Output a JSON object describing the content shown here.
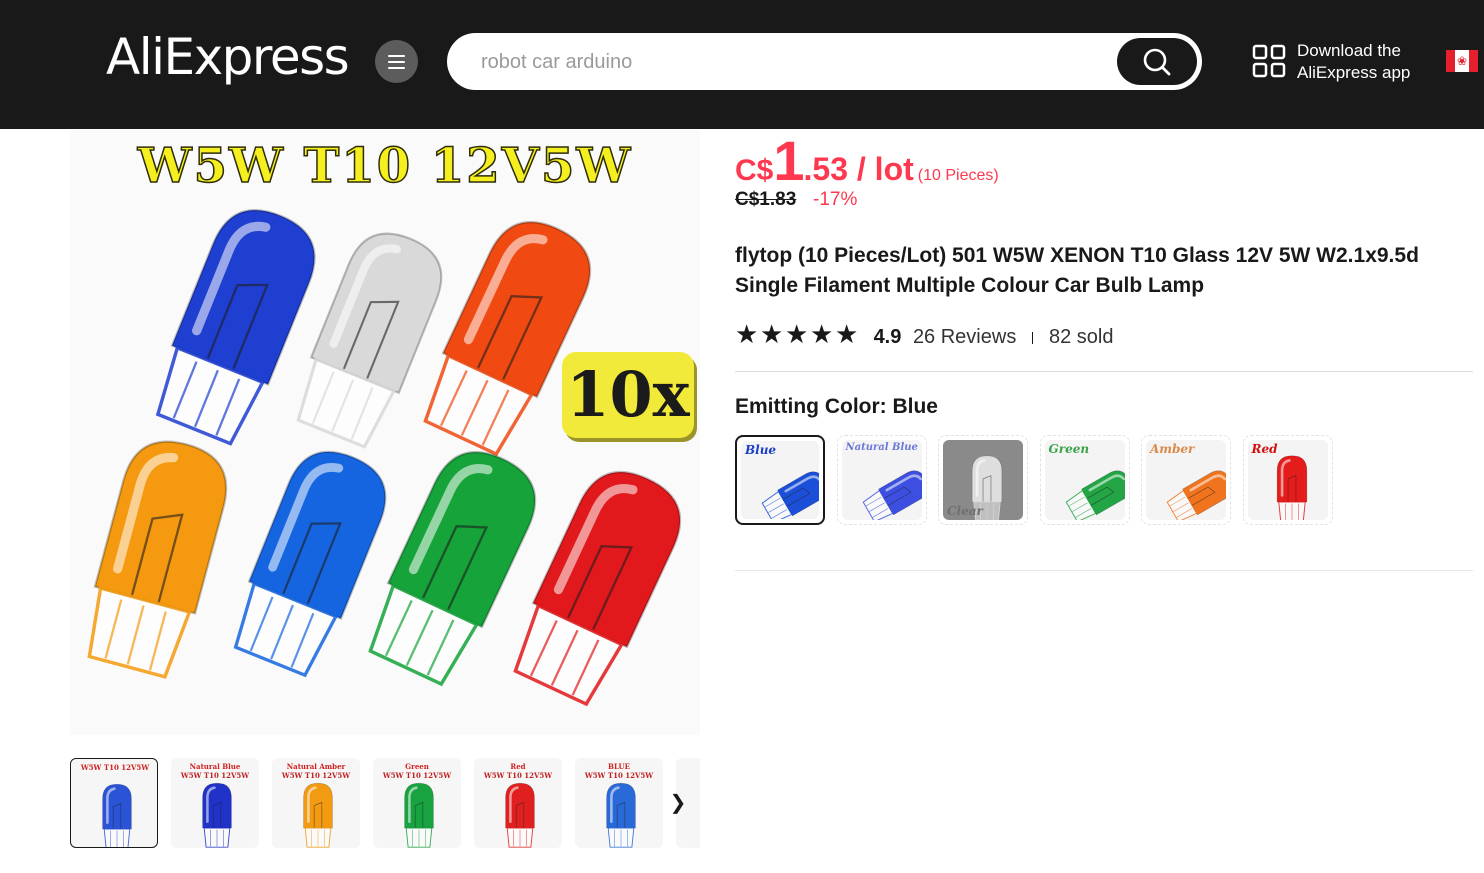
{
  "header": {
    "logo": "AliExpress",
    "search": {
      "placeholder": "robot car arduino"
    },
    "app_download": {
      "line1": "Download the",
      "line2": "AliExpress app"
    },
    "country": "Canada"
  },
  "gallery": {
    "main_title": "W5W T10 12V5W",
    "badge": "10x",
    "bulbs": [
      {
        "color": "#1f3fd1",
        "glass": "Blue"
      },
      {
        "color": "#d9d9d9",
        "glass": "Clear"
      },
      {
        "color": "#f04a12",
        "glass": "Orange"
      },
      {
        "color": "#f59a10",
        "glass": "Amber"
      },
      {
        "color": "#1565e0",
        "glass": "Blue"
      },
      {
        "color": "#15a33a",
        "glass": "Green"
      },
      {
        "color": "#e2191c",
        "glass": "Red"
      }
    ],
    "thumbnails": [
      {
        "caption": "W5W T10 12V5W",
        "sub": "",
        "color": "#2b53d6"
      },
      {
        "caption": "Natural Blue",
        "sub": "W5W T10 12V5W",
        "color": "#2032c8"
      },
      {
        "caption": "Natural Amber",
        "sub": "W5W T10 12V5W",
        "color": "#f29a12"
      },
      {
        "caption": "Green",
        "sub": "W5W T10 12V5W",
        "color": "#18a240"
      },
      {
        "caption": "Red",
        "sub": "W5W T10 12V5W",
        "color": "#e0201e"
      },
      {
        "caption": "BLUE",
        "sub": "W5W T10 12V5W",
        "color": "#2a69d8"
      },
      {
        "caption": "Bl",
        "sub": "",
        "color": "#cfd8f0"
      }
    ]
  },
  "product": {
    "currency": "C$",
    "price_int": "1",
    "price_dec": ".53 / lot",
    "pieces": "(10 Pieces)",
    "original_price": "C$1.83",
    "discount": "-17%",
    "title": "flytop (10 Pieces/Lot) 501 W5W XENON T10 Glass 12V 5W W2.1x9.5d Single Filament Multiple Colour Car Bulb Lamp",
    "rating": "4.9",
    "stars": 5,
    "reviews": "26 Reviews",
    "sold": "82 sold",
    "sku_label": "Emitting Color: Blue",
    "sku_options": [
      {
        "label": "Blue",
        "color": "#1c4fd8",
        "label_color": "#1a3cc8",
        "selected": true
      },
      {
        "label": "Natural Blue",
        "color": "#3d4fe0",
        "label_color": "#6a78d8",
        "selected": false
      },
      {
        "label": "Clear",
        "color": "#dedede",
        "label_color": "#6f6f6f",
        "selected": false
      },
      {
        "label": "Green",
        "color": "#23a445",
        "label_color": "#3aa24a",
        "selected": false
      },
      {
        "label": "Amber",
        "color": "#f0741e",
        "label_color": "#d98a4a",
        "selected": false
      },
      {
        "label": "Red",
        "color": "#e51c1c",
        "label_color": "#d01010",
        "selected": false
      }
    ]
  }
}
